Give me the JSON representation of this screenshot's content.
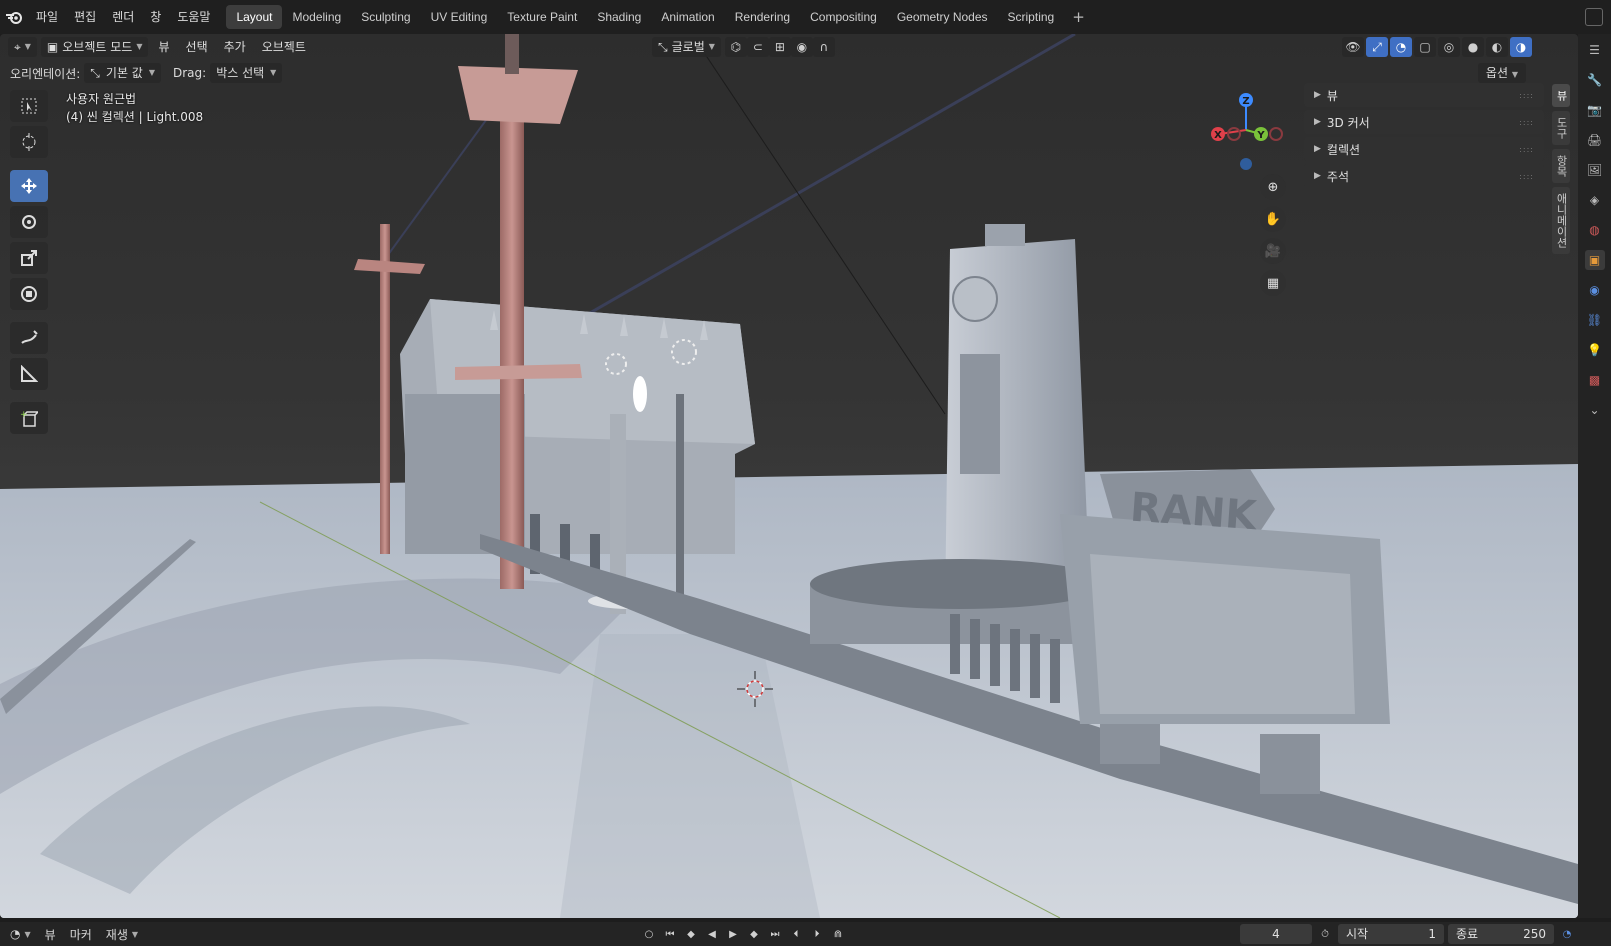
{
  "topbar": {
    "menus": [
      "파일",
      "편집",
      "렌더",
      "창",
      "도움말"
    ],
    "workspaces": [
      "Layout",
      "Modeling",
      "Sculpting",
      "UV Editing",
      "Texture Paint",
      "Shading",
      "Animation",
      "Rendering",
      "Compositing",
      "Geometry Nodes",
      "Scripting"
    ],
    "active_workspace": "Layout",
    "add_label": "+"
  },
  "viewport_header": {
    "mode": "오브젝트 모드",
    "menus": [
      "뷰",
      "선택",
      "추가",
      "오브젝트"
    ],
    "orientation": "글로벌"
  },
  "tool_settings": {
    "orientation_label": "오리엔테이션:",
    "orientation_value": "기본 값",
    "drag_label": "Drag:",
    "drag_value": "박스 선택",
    "options_label": "옵션"
  },
  "viewport_info": {
    "view_name": "사용자 원근법",
    "collection": "(4) 씬 컬렉션 | Light.008"
  },
  "gizmo": {
    "x": "X",
    "y": "Y",
    "z": "Z"
  },
  "n_panel": {
    "panels": [
      "뷰",
      "3D 커서",
      "컬렉션",
      "주석"
    ],
    "tabs": [
      "뷰",
      "도구",
      "항목",
      "애니메이션"
    ]
  },
  "timeline": {
    "menus": [
      "뷰",
      "마커"
    ],
    "playback": "재생",
    "current_frame": "4",
    "start_label": "시작",
    "start_value": "1",
    "end_label": "종료",
    "end_value": "250"
  },
  "colors": {
    "accent": "#4772b3",
    "axis_x": "#e0404a",
    "axis_y": "#7ac23a",
    "axis_z": "#3d8bff"
  }
}
